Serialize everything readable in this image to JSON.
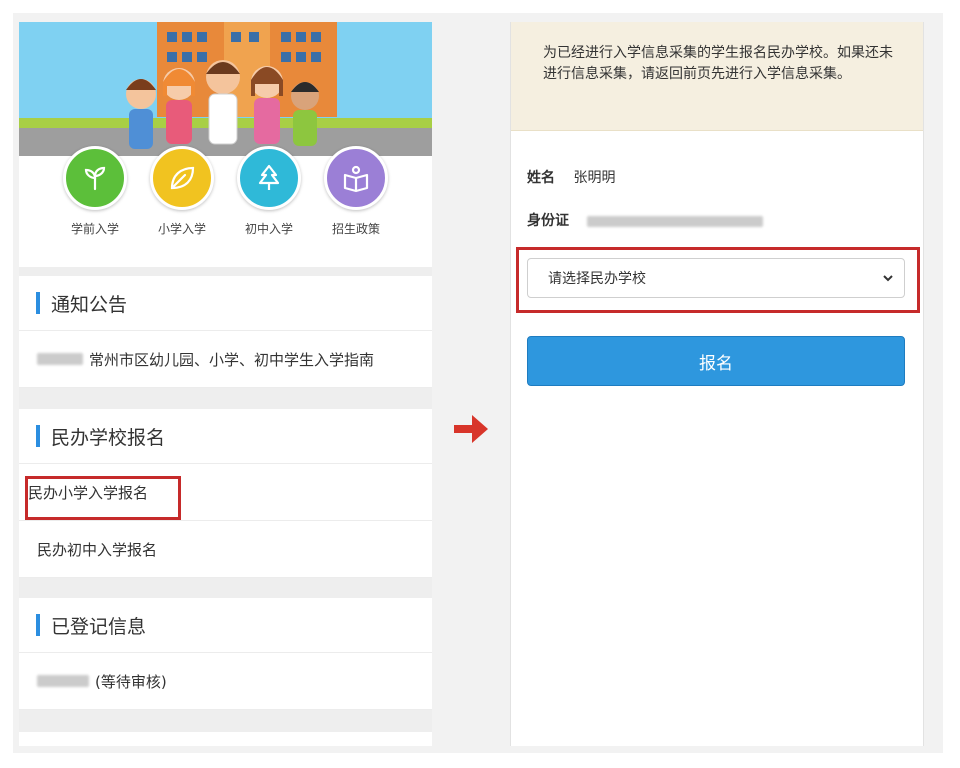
{
  "categories": [
    {
      "label": "学前入学",
      "icon": "sprout-icon",
      "color": "#5cbf3a"
    },
    {
      "label": "小学入学",
      "icon": "leaf-icon",
      "color": "#f1c320"
    },
    {
      "label": "初中入学",
      "icon": "tree-icon",
      "color": "#2fb9d8"
    },
    {
      "label": "招生政策",
      "icon": "book-icon",
      "color": "#9b7fd6"
    }
  ],
  "sections": {
    "notice": {
      "title": "通知公告",
      "items": [
        {
          "text": "常州市区幼儿园、小学、初中学生入学指南"
        }
      ]
    },
    "private_school": {
      "title": "民办学校报名",
      "items": [
        {
          "text": "民办小学入学报名"
        },
        {
          "text": "民办初中入学报名"
        }
      ]
    },
    "registered": {
      "title": "已登记信息",
      "items": [
        {
          "text": "(等待审核)"
        }
      ]
    }
  },
  "right": {
    "notice_text": "为已经进行入学信息采集的学生报名民办学校。如果还未进行信息采集，请返回前页先进行入学信息采集。",
    "name_label": "姓名",
    "name_value": "张明明",
    "id_label": "身份证",
    "select_placeholder": "请选择民办学校",
    "submit_label": "报名"
  },
  "colors": {
    "accent_blue": "#2b8ee0",
    "highlight_red": "#c62a2a",
    "arrow_red": "#d8352a",
    "notice_bg": "#f5efe0"
  }
}
